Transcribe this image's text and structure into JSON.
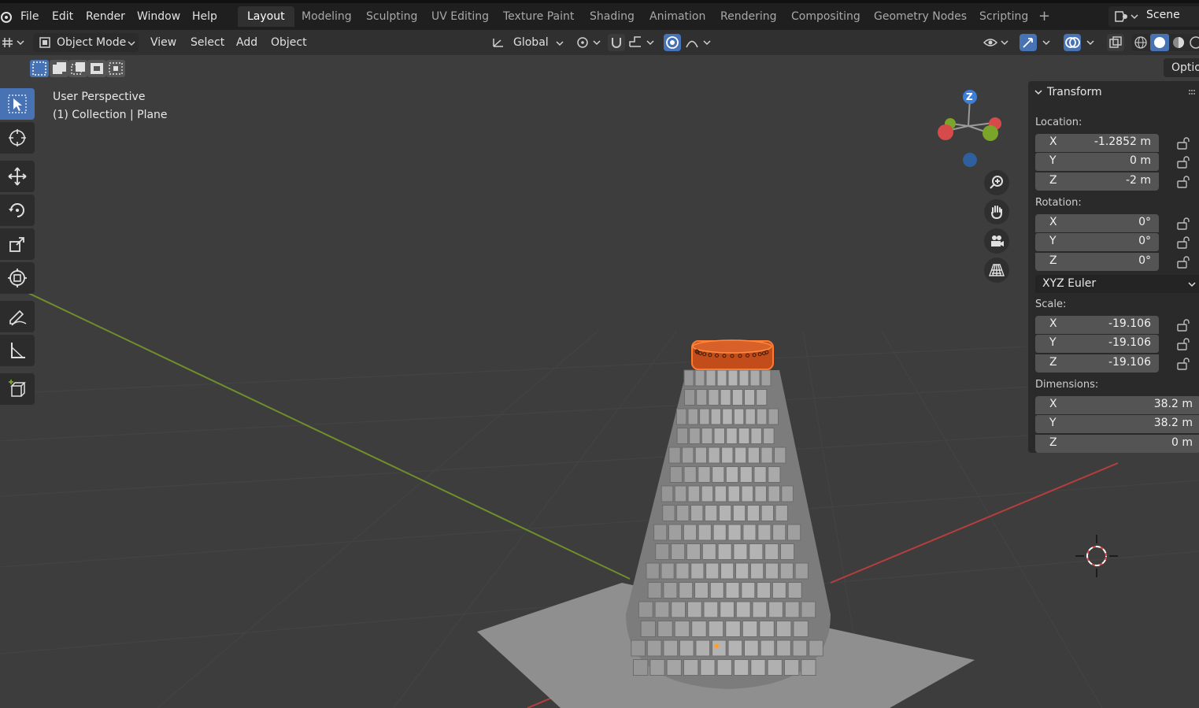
{
  "menu": {
    "items": [
      "File",
      "Edit",
      "Render",
      "Window",
      "Help"
    ]
  },
  "workspaces": [
    "Layout",
    "Modeling",
    "Sculpting",
    "UV Editing",
    "Texture Paint",
    "Shading",
    "Animation",
    "Rendering",
    "Compositing",
    "Geometry Nodes",
    "Scripting"
  ],
  "active_workspace": "Layout",
  "scene_name": "Scene",
  "header": {
    "mode": "Object Mode",
    "menus": [
      "View",
      "Select",
      "Add",
      "Object"
    ],
    "transform_orientation": "Global"
  },
  "viewport": {
    "info_line1": "User Perspective",
    "info_line2": "(1) Collection | Plane",
    "options_label": "Optio"
  },
  "gizmo": {
    "z_label": "Z"
  },
  "transform_panel": {
    "title": "Transform",
    "location_label": "Location:",
    "location": [
      {
        "axis": "X",
        "value": "-1.2852 m"
      },
      {
        "axis": "Y",
        "value": "0 m"
      },
      {
        "axis": "Z",
        "value": "-2 m"
      }
    ],
    "rotation_label": "Rotation:",
    "rotation": [
      {
        "axis": "X",
        "value": "0°"
      },
      {
        "axis": "Y",
        "value": "0°"
      },
      {
        "axis": "Z",
        "value": "0°"
      }
    ],
    "rotation_mode": "XYZ Euler",
    "scale_label": "Scale:",
    "scale": [
      {
        "axis": "X",
        "value": "-19.106"
      },
      {
        "axis": "Y",
        "value": "-19.106"
      },
      {
        "axis": "Z",
        "value": "-19.106"
      }
    ],
    "dimensions_label": "Dimensions:",
    "dimensions": [
      {
        "axis": "X",
        "value": "38.2 m"
      },
      {
        "axis": "Y",
        "value": "38.2 m"
      },
      {
        "axis": "Z",
        "value": "0 m"
      }
    ]
  },
  "colors": {
    "accent": "#4772b3",
    "selection": "#ff7a2f",
    "x_axis": "#d64a4a",
    "y_axis": "#7aa52a",
    "z_axis": "#3b7fdb"
  }
}
